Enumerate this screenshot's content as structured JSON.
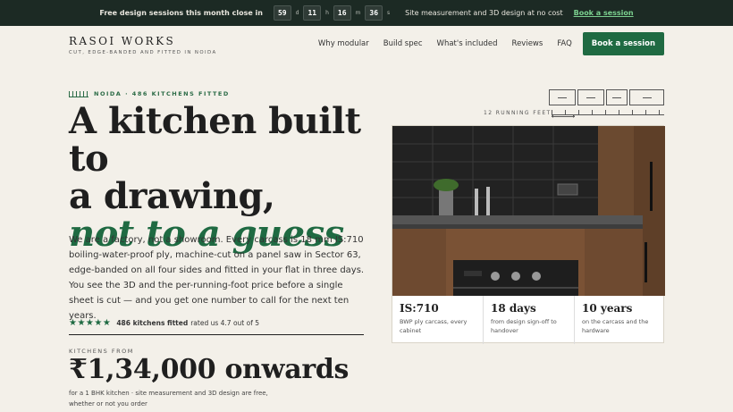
{
  "topbar": {
    "promo": "Free design sessions this month close in",
    "countdown": [
      {
        "value": "59",
        "unit": "d"
      },
      {
        "value": "11",
        "unit": "h"
      },
      {
        "value": "16",
        "unit": "m"
      },
      {
        "value": "36",
        "unit": "s"
      }
    ],
    "note": "Site measurement and 3D design at no cost",
    "cta": "Book a session"
  },
  "brand": {
    "name": "RASOI WORKS",
    "tagline": "Cut, edge-banded and fitted in Noida"
  },
  "nav": {
    "items": [
      "Why modular",
      "Build spec",
      "What's included",
      "Reviews",
      "FAQ"
    ],
    "cta": "Book a session"
  },
  "hero": {
    "eyebrow": "Noida · 486 kitchens fitted",
    "headline_line1": "A kitchen built to",
    "headline_line2": "a drawing,",
    "headline_accent": "not to a guess",
    "lede": "We are a factory, not a showroom. Every carcass is 18 mm IS:710 boiling-water-proof ply, machine-cut on a panel saw in Sector 63, edge-banded on all four sides and fitted in your flat in three days. You see the 3D and the per-running-foot price before a single sheet is cut — and you get one number to call for the next ten years.",
    "rating": {
      "stars": 4.7,
      "count_label": "486 kitchens fitted",
      "text": "rated us 4.7 out of 5"
    },
    "price_label": "Kitchens from",
    "price": "₹1,34,000 onwards",
    "price_note": "for a 1 BHK kitchen · site measurement and 3D design are free, whether or not you order"
  },
  "diagram": {
    "label": "12 running feet"
  },
  "stats": [
    {
      "value": "IS:710",
      "desc": "BWP ply carcass, every cabinet"
    },
    {
      "value": "18 days",
      "desc": "from design sign-off to handover"
    },
    {
      "value": "10 years",
      "desc": "on the carcass and the hardware"
    }
  ]
}
